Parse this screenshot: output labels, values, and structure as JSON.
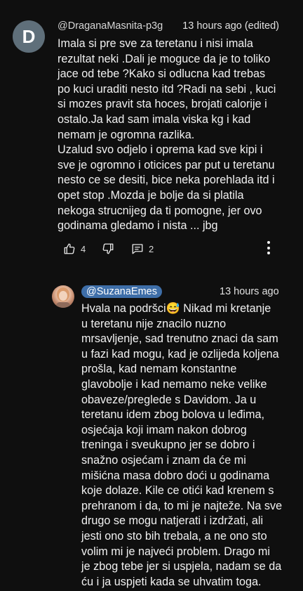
{
  "top_comment": {
    "avatar_letter": "D",
    "author": "@DraganaMasnita-p3g",
    "time": "13 hours ago (edited)",
    "text": "Imala si pre sve za teretanu i nisi imala\nrezultat neki .Dali je moguce da je to toliko\njace od tebe ?Kako si odlucna kad trebas\npo kuci uraditi nesto itd ?Radi  na sebi , kuci\nsi mozes pravit sta hoces, brojati calorije i\nostalo.Ja kad sam imala viska kg i kad\nnemam je ogromna razlika.\nUzalud svo odjelo i oprema kad sve kipi i\nsve je ogromno i oticices par put u teretanu\nnesto ce se desiti, bice neka porehlada itd i\nopet stop .Mozda je bolje da si platila\nnekoga strucnijeg da ti pomogne, jer ovo\ngodinama gledamo i nista  ... jbg",
    "like_count": "4",
    "reply_count": "2",
    "icons": {
      "like": "thumb-up-icon",
      "dislike": "thumb-down-icon",
      "replies": "comment-icon",
      "more": "more-vertical-icon"
    }
  },
  "reply": {
    "author": "@SuzanaEmes",
    "time": "13 hours ago",
    "text": "Hvala na podršci😅 Nikad mi kretanje\nu teretanu nije znacilo nuzno\nmrsavljenje, sad trenutno znaci da sam\nu fazi kad mogu, kad je ozlijeda koljena\nprošla, kad nemam konstantne\nglavobolje i kad nemamo neke velike\nobaveze/preglede s Davidom.  Ja u\nteretanu idem zbog bolova u leđima,\nosjećaja koji imam nakon dobrog\ntreninga i sveukupno jer se dobro i\nsnažno osjećam i znam da će mi\nmišićna masa dobro doći u godinama\nkoje dolaze. Kile ce otići kad krenem s\nprehranom i da, to mi je najteže. Na sve\ndrugo se mogu natjerati i izdržati, ali\njesti ono sto bih trebala, a ne ono sto\nvolim mi je najveći problem. Drago mi\nje zbog tebe jer si uspjela, nadam se da\nću i ja uspjeti kada se uhvatim toga."
  },
  "colors": {
    "background": "#0f0f0f",
    "text": "#f1f1f1",
    "avatar_d": "#5f6f7a",
    "handle_pill": "#3e6ea8"
  }
}
